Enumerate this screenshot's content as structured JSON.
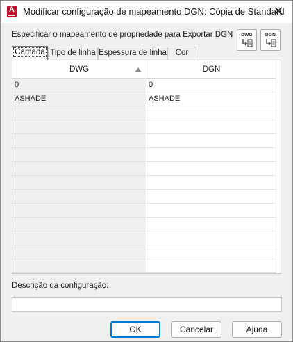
{
  "window": {
    "title": "Modificar configuração de mapeamento DGN: Cópia de Standard",
    "app_icon_letter": "A",
    "close_glyph": "✕"
  },
  "instruction": "Especificar o mapeamento de propriedade para Exportar DGN",
  "toolbar": {
    "dwg_button_label": "DWG",
    "dgn_button_label": "DGN",
    "dwg_button_icon": "import-mapping-icon",
    "dgn_button_icon": "import-mapping-icon"
  },
  "tabs": [
    {
      "label": "Camada",
      "active": true
    },
    {
      "label": "Tipo de linha",
      "active": false
    },
    {
      "label": "Espessura de linha",
      "active": false
    },
    {
      "label": "Cor",
      "active": false
    }
  ],
  "grid": {
    "columns": [
      "DWG",
      "DGN"
    ],
    "sort_column": "DWG",
    "sort_direction": "ascending",
    "rows": [
      {
        "dwg": "0",
        "dgn": "0"
      },
      {
        "dwg": "ASHADE",
        "dgn": "ASHADE"
      },
      {
        "dwg": "",
        "dgn": ""
      },
      {
        "dwg": "",
        "dgn": ""
      },
      {
        "dwg": "",
        "dgn": ""
      },
      {
        "dwg": "",
        "dgn": ""
      },
      {
        "dwg": "",
        "dgn": ""
      },
      {
        "dwg": "",
        "dgn": ""
      },
      {
        "dwg": "",
        "dgn": ""
      },
      {
        "dwg": "",
        "dgn": ""
      },
      {
        "dwg": "",
        "dgn": ""
      },
      {
        "dwg": "",
        "dgn": ""
      },
      {
        "dwg": "",
        "dgn": ""
      },
      {
        "dwg": "",
        "dgn": ""
      }
    ]
  },
  "description": {
    "label": "Descrição da configuração:",
    "value": ""
  },
  "buttons": {
    "ok": "OK",
    "cancel": "Cancelar",
    "help": "Ajuda"
  },
  "colors": {
    "accent": "#0078d4",
    "app_icon": "#c8102e",
    "dialog_bg": "#f0f0f0"
  }
}
